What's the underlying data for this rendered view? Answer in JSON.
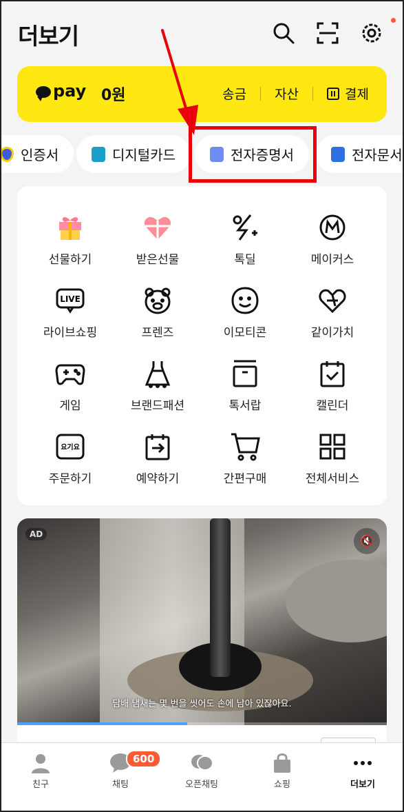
{
  "header": {
    "title": "더보기",
    "icons": [
      "search-icon",
      "scan-icon",
      "gear-icon"
    ]
  },
  "pay": {
    "logo": "pay",
    "amount": "0원",
    "links": {
      "transfer": "송금",
      "assets": "자산",
      "payment": "결제"
    }
  },
  "chips": [
    {
      "label": "인증서",
      "icon": "certificate-shield-icon"
    },
    {
      "label": "디지털카드",
      "icon": "digital-card-icon"
    },
    {
      "label": "전자증명서",
      "icon": "e-certificate-icon"
    },
    {
      "label": "전자문서",
      "icon": "e-document-icon"
    }
  ],
  "services": [
    {
      "label": "선물하기",
      "icon": "gift-box-icon"
    },
    {
      "label": "받은선물",
      "icon": "received-gift-heart-icon"
    },
    {
      "label": "톡딜",
      "icon": "percent-bolt-icon"
    },
    {
      "label": "메이커스",
      "icon": "makers-m-icon"
    },
    {
      "label": "라이브쇼핑",
      "icon": "live-tv-icon"
    },
    {
      "label": "프렌즈",
      "icon": "friends-bear-icon"
    },
    {
      "label": "이모티콘",
      "icon": "emoticon-smile-icon"
    },
    {
      "label": "같이가치",
      "icon": "together-heart-icon"
    },
    {
      "label": "게임",
      "icon": "gamepad-icon"
    },
    {
      "label": "브랜드패션",
      "icon": "dress-icon"
    },
    {
      "label": "톡서랍",
      "icon": "drawer-icon"
    },
    {
      "label": "캘린더",
      "icon": "calendar-check-icon"
    },
    {
      "label": "주문하기",
      "icon": "yogiyo-icon"
    },
    {
      "label": "예약하기",
      "icon": "reservation-icon"
    },
    {
      "label": "간편구매",
      "icon": "cart-icon"
    },
    {
      "label": "전체서비스",
      "icon": "grid-icon"
    }
  ],
  "service_icon_text": {
    "live": "LIVE",
    "yogiyo": "요기요"
  },
  "ad": {
    "badge": "AD",
    "subtitle": "담배 냄새는 몇 번을 씻어도 손에 남아 있잖아요.",
    "progress": 0.46
  },
  "nav": [
    {
      "label": "친구",
      "icon": "friends-person-icon"
    },
    {
      "label": "채팅",
      "icon": "chat-bubble-icon",
      "badge": "600"
    },
    {
      "label": "오픈채팅",
      "icon": "open-chat-icon"
    },
    {
      "label": "쇼핑",
      "icon": "shopping-bag-icon"
    },
    {
      "label": "더보기",
      "icon": "more-dots-icon",
      "active": true
    }
  ],
  "colors": {
    "pay_yellow": "#ffe812",
    "highlight_red": "#e8000b",
    "badge_orange": "#ff5a36",
    "progress_blue": "#4aa3ff"
  }
}
